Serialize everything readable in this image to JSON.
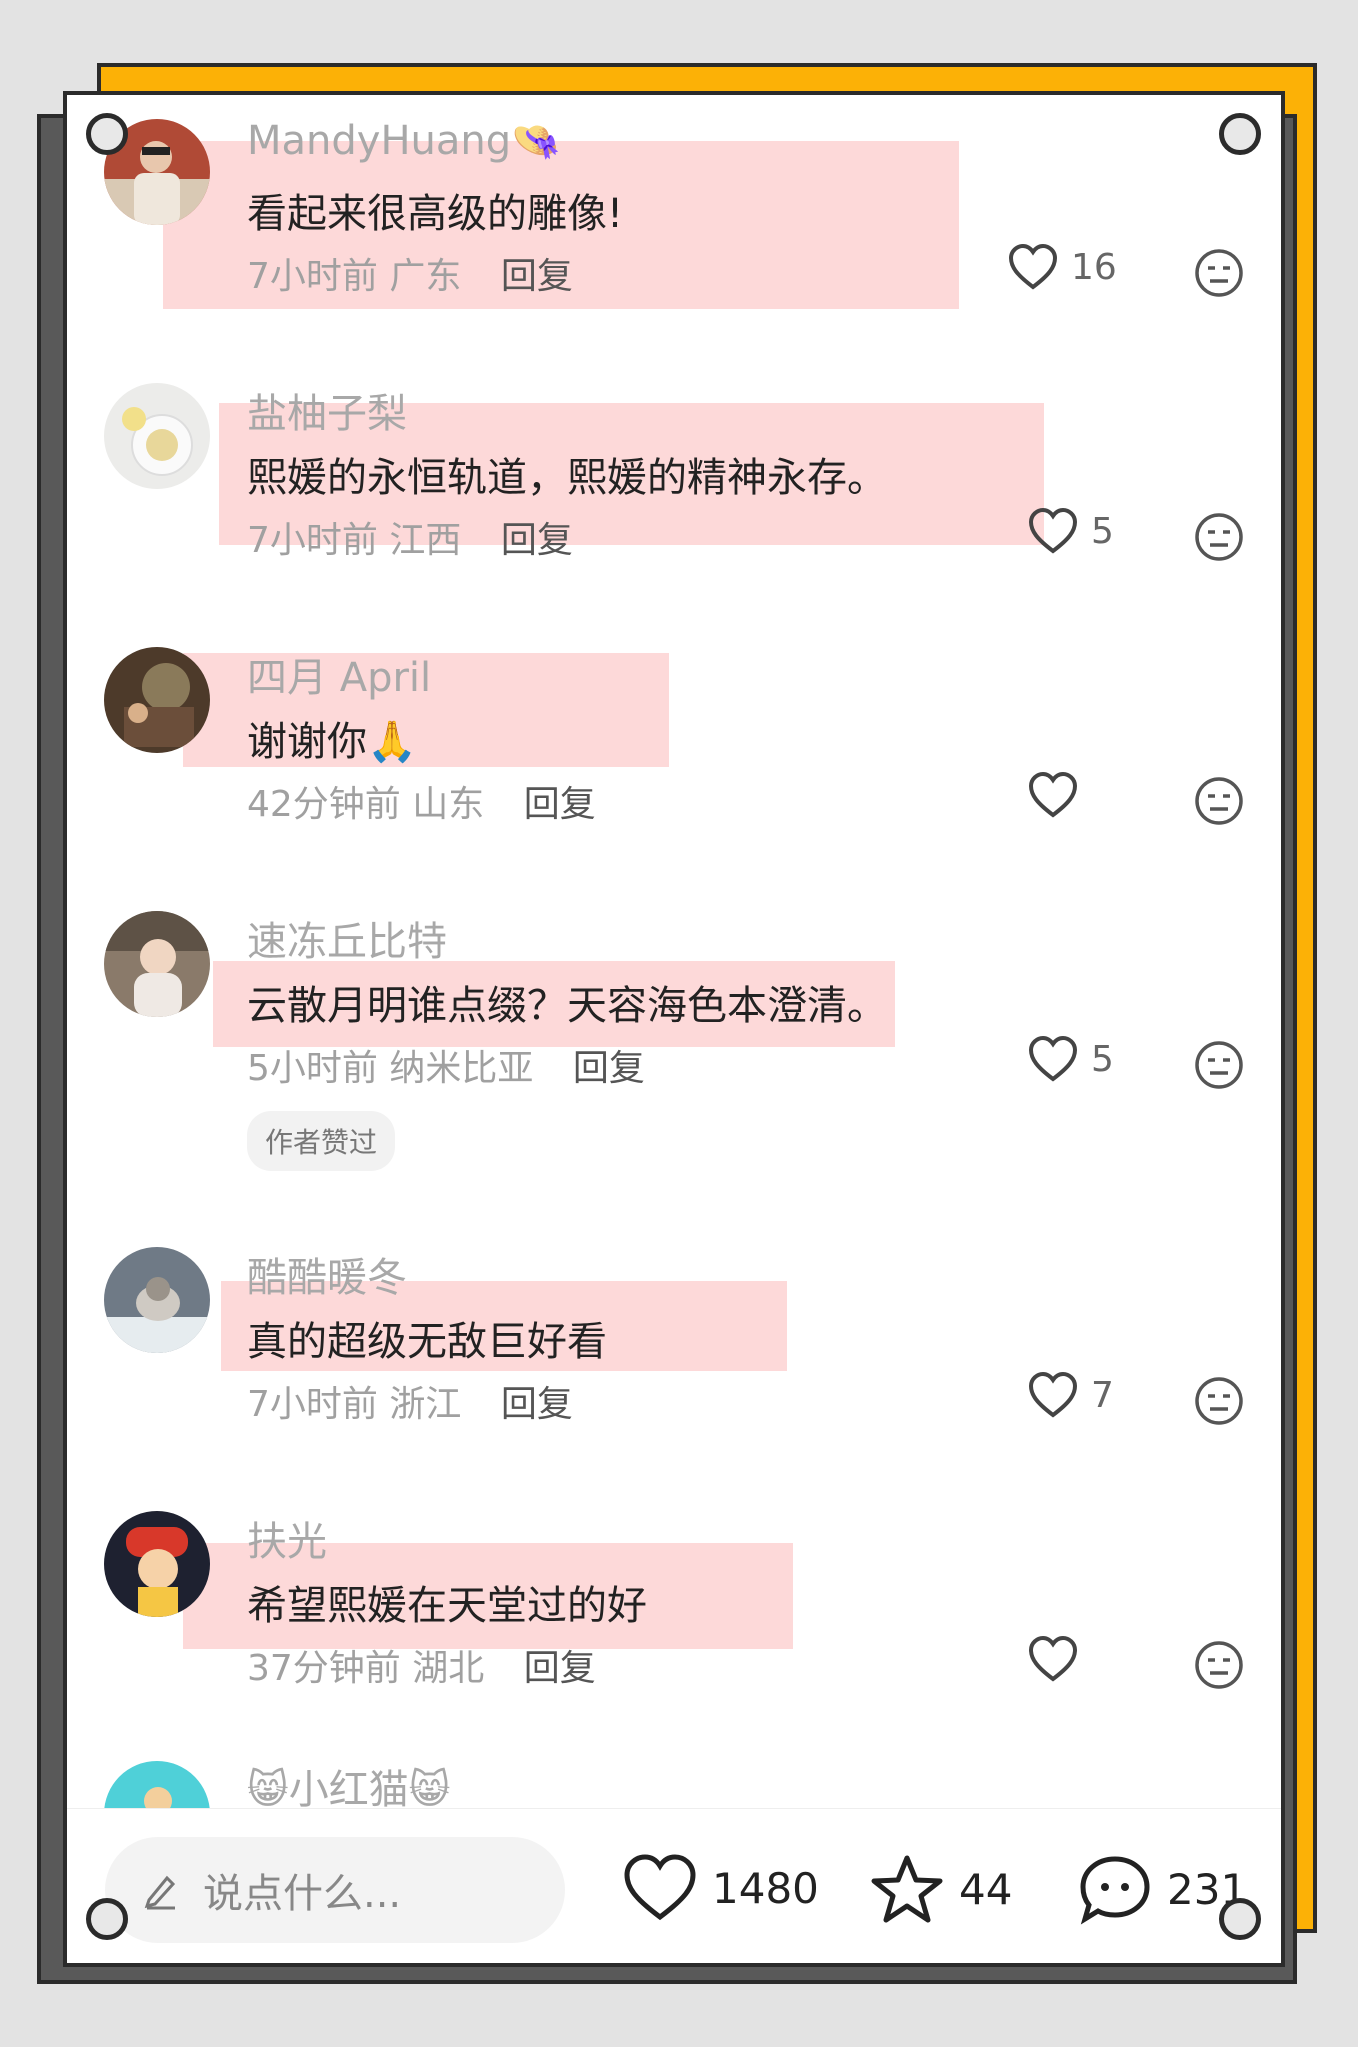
{
  "comments": [
    {
      "user": "MandyHuang",
      "user_emoji": "👒",
      "text": "看起来很高级的雕像!",
      "time": "7小时前",
      "location": "广东",
      "reply_label": "回复",
      "likes": "16",
      "author_liked": null
    },
    {
      "user": "盐柚子梨",
      "user_emoji": "",
      "text": "熙媛的永恒轨道，熙媛的精神永存。",
      "time": "7小时前",
      "location": "江西",
      "reply_label": "回复",
      "likes": "5",
      "author_liked": null
    },
    {
      "user": "四月 April",
      "user_emoji": "",
      "text": "谢谢你🙏",
      "time": "42分钟前",
      "location": "山东",
      "reply_label": "回复",
      "likes": "",
      "author_liked": null
    },
    {
      "user": "速冻丘比特",
      "user_emoji": "",
      "text": "云散月明谁点缀？天容海色本澄清。",
      "time": "5小时前",
      "location": "纳米比亚",
      "reply_label": "回复",
      "likes": "5",
      "author_liked": "作者赞过"
    },
    {
      "user": "酷酷暖冬",
      "user_emoji": "",
      "text": "真的超级无敌巨好看",
      "time": "7小时前",
      "location": "浙江",
      "reply_label": "回复",
      "likes": "7",
      "author_liked": null
    },
    {
      "user": "扶光",
      "user_emoji": "",
      "text": "希望熙媛在天堂过的好",
      "time": "37分钟前",
      "location": "湖北",
      "reply_label": "回复",
      "likes": "",
      "author_liked": null
    },
    {
      "user": "😸小红猫😸",
      "user_emoji": "",
      "text": "",
      "time": "",
      "location": "",
      "reply_label": "",
      "likes": "",
      "author_liked": null
    }
  ],
  "bottom_bar": {
    "input_placeholder": "说点什么...",
    "likes_total": "1480",
    "stars_total": "44",
    "comments_total": "231"
  },
  "colors": {
    "frame_yellow": "#fcb106",
    "frame_gray": "#595959",
    "highlight_pink": "#fdd9d9"
  }
}
